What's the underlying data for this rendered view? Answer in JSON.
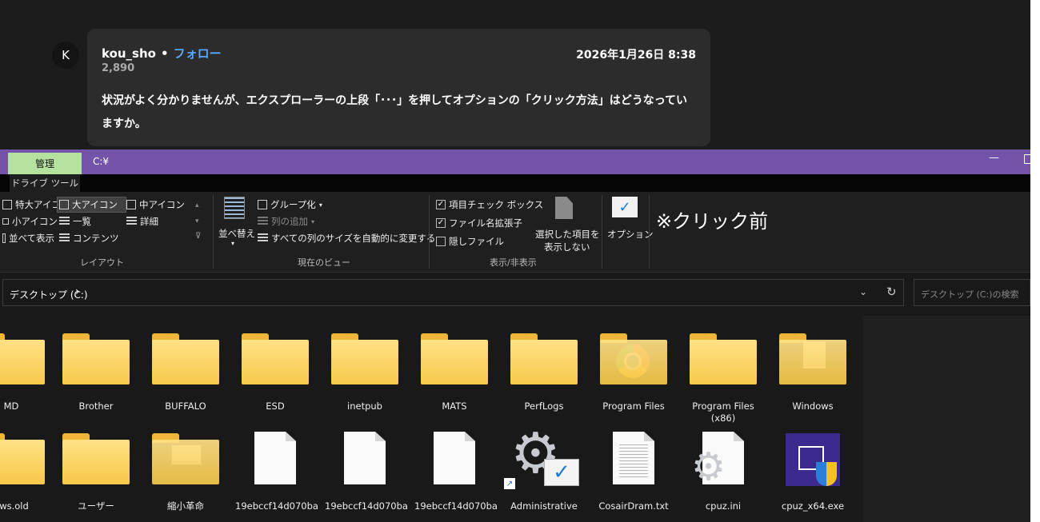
{
  "post": {
    "avatar_initial": "K",
    "username": "kou_sho",
    "separator": "•",
    "follow_label": "フォロー",
    "score": "2,890",
    "date": "2026年1月26日 8:38",
    "body": "状況がよく分かりませんが、エクスプローラーの上段「･･･」を押してオプションの「クリック方法」はどうなっていますか。"
  },
  "explorer": {
    "tab_manage": "管理",
    "title_path": "C:¥",
    "drive_tools_tab": "ドライブ ツール",
    "window_min": "—",
    "ribbon": {
      "layout": {
        "items": [
          "特大アイコン",
          "大アイコン",
          "中アイコン",
          "小アイコン",
          "一覧",
          "詳細",
          "並べて表示",
          "コンテンツ"
        ],
        "selected": "大アイコン",
        "group_label": "レイアウト"
      },
      "current_view": {
        "sort_label": "並べ替え",
        "group_by": "グループ化",
        "add_column": "列の追加",
        "autofit": "すべての列のサイズを自動的に変更する",
        "group_label": "現在のビュー"
      },
      "show_hide": {
        "item_checkbox": "項目チェック ボックス",
        "extensions": "ファイル名拡張子",
        "hidden_files": "隠しファイル",
        "hide_selected_line1": "選択した項目を",
        "hide_selected_line2": "表示しない",
        "group_label": "表示/非表示",
        "item_checkbox_checked": true,
        "extensions_checked": true,
        "hidden_files_checked": false
      },
      "options_label": "オプション"
    },
    "annotation": "※クリック前",
    "address": {
      "path": "デスクトップ (C:)",
      "chevron": "›",
      "dropdown": "⌄",
      "refresh": "↻",
      "search_placeholder": "デスクトップ (C:)の検索"
    },
    "row1": [
      "MD",
      "Brother",
      "BUFFALO",
      "ESD",
      "inetpub",
      "MATS",
      "PerfLogs",
      "Program Files",
      "Program Files (x86)",
      "Windows"
    ],
    "row2": [
      "ows.old",
      "ユーザー",
      "縮小革命",
      "19ebccf14d070ba",
      "19ebccf14d070ba",
      "19ebccf14d070ba",
      "Administrative",
      "CosairDram.txt",
      "cpuz.ini",
      "cpuz_x64.exe"
    ]
  }
}
